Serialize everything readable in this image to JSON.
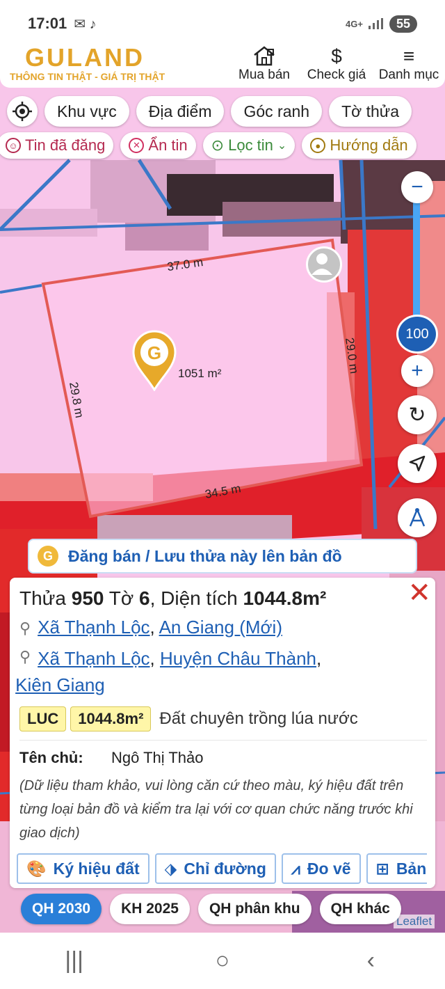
{
  "status_bar": {
    "time": "17:01",
    "network": "4G+",
    "battery": "55"
  },
  "header": {
    "logo": "GULAND",
    "slogan": "THÔNG TIN THẬT - GIÁ TRỊ THẬT",
    "nav": [
      {
        "label": "Mua bán",
        "icon": "house-icon"
      },
      {
        "label": "Check giá",
        "icon": "dollar-icon"
      },
      {
        "label": "Danh mục",
        "icon": "menu-icon"
      }
    ]
  },
  "search_chips": [
    "Khu vực",
    "Địa điểm",
    "Góc ranh",
    "Tờ thửa"
  ],
  "filter_chips": {
    "posted": "Tin đã đăng",
    "hidden": "Ẩn tin",
    "filter": "Lọc tin",
    "guide": "Hướng dẫn"
  },
  "map": {
    "zoom": "100",
    "area_label": "1051 m²",
    "edge_top": "37.0 m",
    "edge_right": "29.0 m",
    "edge_left": "29.8 m",
    "edge_bottom": "34.5 m",
    "attribution": "Leaflet"
  },
  "post_banner": "Đăng bán / Lưu thửa này lên bản đồ",
  "parcel": {
    "t1": "Thửa ",
    "parcel_no": "950",
    "t2": " Tờ ",
    "sheet_no": "6",
    "t3": ", Diện tích ",
    "area": "1044.8m²",
    "address_new": {
      "commune": "Xã Thạnh Lộc",
      "province": "An Giang (Mới)"
    },
    "address_old": {
      "commune": "Xã Thạnh Lộc",
      "district": "Huyện Châu Thành",
      "province": "Kiên Giang"
    },
    "land_code": "LUC",
    "land_area": "1044.8m²",
    "land_type": "Đất chuyên trồng lúa nước",
    "owner_label": "Tên chủ:",
    "owner_name": "Ngô Thị Thảo",
    "note": "(Dữ liệu tham khảo, vui lòng căn cứ theo màu, ký hiệu đất trên từng loại bản đồ và kiểm tra lại với cơ quan chức năng trước khi giao dịch)",
    "actions": [
      "Ký hiệu đất",
      "Chỉ đường",
      "Đo vẽ",
      "Bản"
    ]
  },
  "plans": [
    {
      "label": "QH 2030",
      "active": true
    },
    {
      "label": "KH 2025",
      "active": false
    },
    {
      "label": "QH phân khu",
      "active": false
    },
    {
      "label": "QH khác",
      "active": false
    }
  ],
  "colors": {
    "brand": "#e3a42a",
    "accent_blue": "#1e5fb4",
    "active_chip": "#2a7fd8",
    "rice_land_pink": "#f8c6ea",
    "road_red": "#e0202a"
  }
}
